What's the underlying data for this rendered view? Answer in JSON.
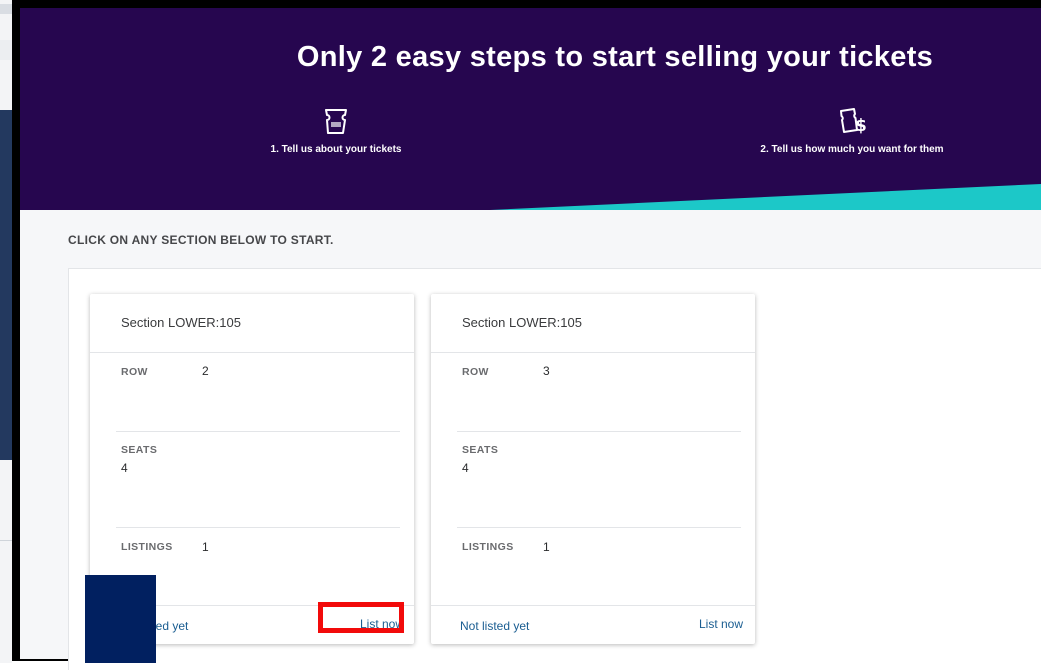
{
  "hero": {
    "title": "Only 2 easy steps to start selling your tickets",
    "steps": [
      {
        "icon": "ticket-icon",
        "label": "1. Tell us about your tickets"
      },
      {
        "icon": "ticket-price-icon",
        "label": "2. Tell us how much you want for them"
      }
    ]
  },
  "instruction": "CLICK ON ANY SECTION BELOW TO START.",
  "cards": [
    {
      "title": "Section LOWER:105",
      "row_label": "ROW",
      "row_value": "2",
      "seats_label": "SEATS",
      "seats_value": "4",
      "listings_label": "LISTINGS",
      "listings_value": "1",
      "status": "Not listed yet",
      "action": "List now"
    },
    {
      "title": "Section LOWER:105",
      "row_label": "ROW",
      "row_value": "3",
      "seats_label": "SEATS",
      "seats_value": "4",
      "listings_label": "LISTINGS",
      "listings_value": "1",
      "status": "Not listed yet",
      "action": "List now"
    }
  ],
  "colors": {
    "hero_bg": "#26064f",
    "accent_teal": "#1cc8c8",
    "link": "#1a5d91",
    "highlight": "#f20a0a",
    "occluder": "#012060"
  }
}
